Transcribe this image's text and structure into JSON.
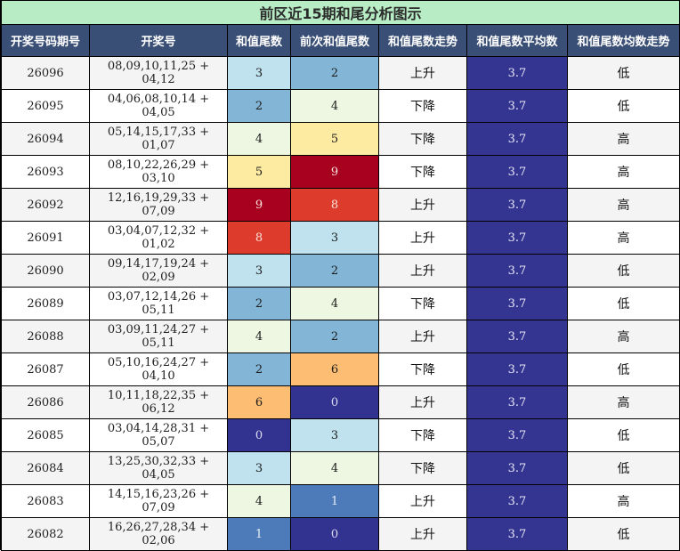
{
  "title": "前区近15期和尾分析图示",
  "headers": [
    "开奖号码期号",
    "开奖号",
    "和值尾数",
    "前次和值尾数",
    "和值尾数走势",
    "和值尾数平均数",
    "和值尾数均数走势"
  ],
  "colors": {
    "title_bg": "#b7ecc5",
    "header_bg": "#3a4f76",
    "avg_bg": "#343591",
    "digit_scale": {
      "0": "#323290",
      "1": "#4d7ab8",
      "2": "#82b5d6",
      "3": "#bfe2ee",
      "4": "#eef7e1",
      "5": "#feeba2",
      "6": "#fdbd72",
      "8": "#dd3b2c",
      "9": "#a8001f"
    }
  },
  "rows": [
    {
      "period": "26096",
      "numbers": "08,09,10,11,25 + 04,12",
      "tail": "3",
      "prev_tail": "2",
      "trend": "上升",
      "avg": "3.7",
      "avg_trend": "低"
    },
    {
      "period": "26095",
      "numbers": "04,06,08,10,14 + 04,05",
      "tail": "2",
      "prev_tail": "4",
      "trend": "下降",
      "avg": "3.7",
      "avg_trend": "低"
    },
    {
      "period": "26094",
      "numbers": "05,14,15,17,33 + 01,07",
      "tail": "4",
      "prev_tail": "5",
      "trend": "下降",
      "avg": "3.7",
      "avg_trend": "高"
    },
    {
      "period": "26093",
      "numbers": "08,10,22,26,29 + 03,10",
      "tail": "5",
      "prev_tail": "9",
      "trend": "下降",
      "avg": "3.7",
      "avg_trend": "高"
    },
    {
      "period": "26092",
      "numbers": "12,16,19,29,33 + 07,09",
      "tail": "9",
      "prev_tail": "8",
      "trend": "上升",
      "avg": "3.7",
      "avg_trend": "高"
    },
    {
      "period": "26091",
      "numbers": "03,04,07,12,32 + 01,02",
      "tail": "8",
      "prev_tail": "3",
      "trend": "上升",
      "avg": "3.7",
      "avg_trend": "高"
    },
    {
      "period": "26090",
      "numbers": "09,14,17,19,24 + 02,09",
      "tail": "3",
      "prev_tail": "2",
      "trend": "上升",
      "avg": "3.7",
      "avg_trend": "低"
    },
    {
      "period": "26089",
      "numbers": "03,07,12,14,26 + 05,11",
      "tail": "2",
      "prev_tail": "4",
      "trend": "下降",
      "avg": "3.7",
      "avg_trend": "低"
    },
    {
      "period": "26088",
      "numbers": "03,09,11,24,27 + 05,11",
      "tail": "4",
      "prev_tail": "2",
      "trend": "上升",
      "avg": "3.7",
      "avg_trend": "高"
    },
    {
      "period": "26087",
      "numbers": "05,10,16,24,27 + 04,10",
      "tail": "2",
      "prev_tail": "6",
      "trend": "下降",
      "avg": "3.7",
      "avg_trend": "低"
    },
    {
      "period": "26086",
      "numbers": "10,11,18,22,35 + 06,12",
      "tail": "6",
      "prev_tail": "0",
      "trend": "上升",
      "avg": "3.7",
      "avg_trend": "高"
    },
    {
      "period": "26085",
      "numbers": "03,04,14,28,31 + 05,07",
      "tail": "0",
      "prev_tail": "3",
      "trend": "下降",
      "avg": "3.7",
      "avg_trend": "低"
    },
    {
      "period": "26084",
      "numbers": "13,25,30,32,33 + 04,05",
      "tail": "3",
      "prev_tail": "4",
      "trend": "下降",
      "avg": "3.7",
      "avg_trend": "低"
    },
    {
      "period": "26083",
      "numbers": "14,15,16,23,26 + 07,09",
      "tail": "4",
      "prev_tail": "1",
      "trend": "上升",
      "avg": "3.7",
      "avg_trend": "高"
    },
    {
      "period": "26082",
      "numbers": "16,26,27,28,34 + 02,06",
      "tail": "1",
      "prev_tail": "0",
      "trend": "上升",
      "avg": "3.7",
      "avg_trend": "低"
    }
  ]
}
